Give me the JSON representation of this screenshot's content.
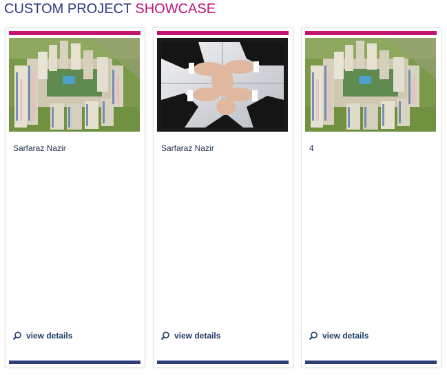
{
  "heading": {
    "part1": "CUSTOM PROJECT ",
    "part2": "SHOWCASE"
  },
  "colors": {
    "accent_pink": "#c31474",
    "accent_navy": "#2c3d7c",
    "heading_blue": "#2b3a7a"
  },
  "cards": [
    {
      "title": "Sarfaraz Nazir",
      "image": "aerial-building-complex",
      "link_label": "view details",
      "link_icon": "magnifier-icon"
    },
    {
      "title": "Sarfaraz Nazir",
      "image": "business-handshake-circle",
      "link_label": "view details",
      "link_icon": "magnifier-icon"
    },
    {
      "title": "4",
      "image": "aerial-building-complex",
      "link_label": "view details",
      "link_icon": "magnifier-icon"
    }
  ]
}
